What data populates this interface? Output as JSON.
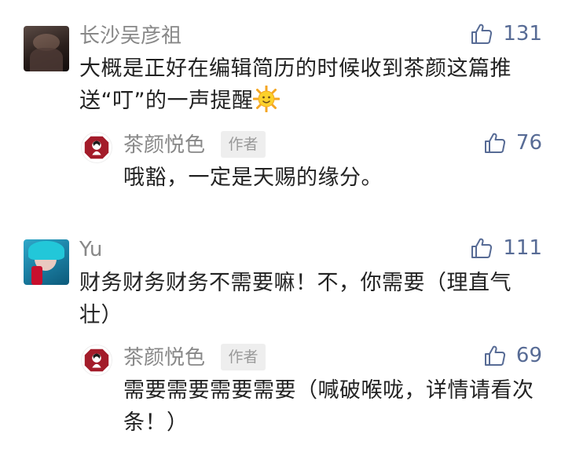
{
  "comments": [
    {
      "author": "长沙吴彦祖",
      "likes": "131",
      "text": "大概是正好在编辑简历的时候收到茶颜这篇推送“叮”的一声提醒",
      "emoji": "sun-emoji",
      "reply": {
        "author": "茶颜悦色",
        "tag": "作者",
        "likes": "76",
        "text": "哦豁，一定是天赐的缘分。"
      }
    },
    {
      "author": "Yu",
      "likes": "111",
      "text": "财务财务财务不需要嘛！不，你需要（理直气壮）",
      "reply": {
        "author": "茶颜悦色",
        "tag": "作者",
        "likes": "69",
        "text": "需要需要需要需要（喊破喉咙，详情请看次条！）"
      }
    }
  ],
  "colors": {
    "like": "#576b95",
    "name": "#888888",
    "text": "#222222",
    "tag_bg": "#eeeeee"
  }
}
